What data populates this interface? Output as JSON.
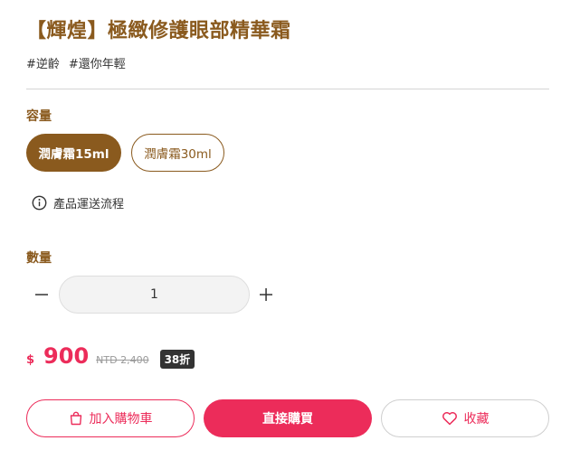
{
  "product": {
    "title": "【輝煌】極緻修護眼部精華霜",
    "tags": [
      "#逆齡",
      "#還你年輕"
    ]
  },
  "capacity": {
    "label": "容量",
    "options": [
      {
        "label": "潤膚霜15ml",
        "selected": true
      },
      {
        "label": "潤膚霜30ml",
        "selected": false
      }
    ]
  },
  "shipping": {
    "label": "產品運送流程",
    "icon": "info-icon"
  },
  "quantity": {
    "label": "數量",
    "value": "1",
    "decrement_icon": "minus-icon",
    "increment_icon": "plus-icon"
  },
  "price": {
    "currency": "$",
    "amount": "900",
    "original": "NTD 2,400",
    "discount_badge": "38折"
  },
  "actions": {
    "add_to_cart": "加入購物車",
    "buy_now": "直接購買",
    "favorite": "收藏",
    "cart_icon": "shopping-bag-icon",
    "favorite_icon": "heart-icon"
  },
  "colors": {
    "brand_brown": "#8a5a1e",
    "accent_pink": "#ec2c5a",
    "badge_dark": "#333333"
  }
}
